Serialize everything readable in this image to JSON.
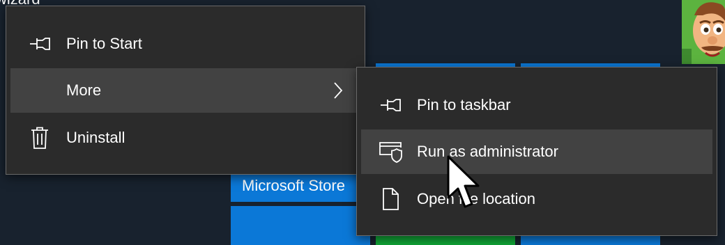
{
  "background": {
    "partial_label": "wizard",
    "tiles": {
      "microsoft_store_label": "Microsoft Store"
    }
  },
  "context_menu": {
    "items": [
      {
        "label": "Pin to Start",
        "icon": "pin-icon"
      },
      {
        "label": "More",
        "icon": "",
        "submenu": true
      },
      {
        "label": "Uninstall",
        "icon": "trash-icon"
      }
    ]
  },
  "submenu": {
    "items": [
      {
        "label": "Pin to taskbar",
        "icon": "pin-icon"
      },
      {
        "label": "Run as administrator",
        "icon": "shield-window-icon"
      },
      {
        "label": "Open file location",
        "icon": "file-icon"
      }
    ]
  },
  "colors": {
    "desktop_bg": "#18222e",
    "menu_bg": "#2b2b2b",
    "menu_hover": "#424242",
    "menu_border": "#6a6a6a",
    "tile_blue": "#0b78d7",
    "tile_green": "#11a637"
  },
  "cursor": "arrow-pointer"
}
